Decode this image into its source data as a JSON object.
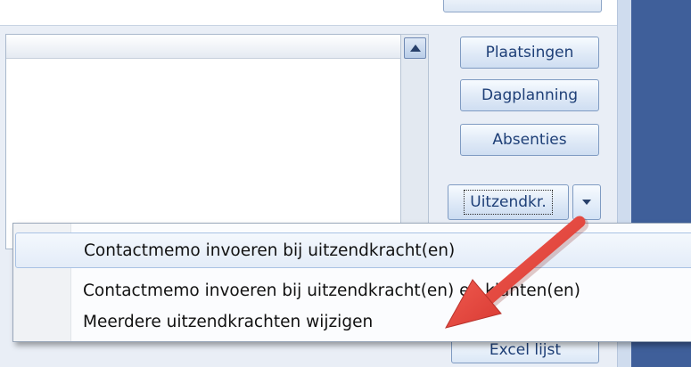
{
  "toolbar": {
    "side_buttons": [
      {
        "label": "Plaatsingen"
      },
      {
        "label": "Dagplanning"
      },
      {
        "label": "Absenties"
      }
    ],
    "split_button": {
      "label": "Uitzendkr.",
      "arrow_icon": "dropdown-arrow-icon"
    },
    "partially_hidden_button": {
      "label": "Excel lijst"
    }
  },
  "context_menu": {
    "items": [
      {
        "label": "Contactmemo invoeren bij uitzendkracht(en)",
        "highlighted": true
      },
      {
        "label": "Contactmemo invoeren bij uitzendkracht(en) en klanten(en)",
        "highlighted": false
      },
      {
        "label": "Meerdere uitzendkrachten wijzigen",
        "highlighted": false
      }
    ]
  },
  "annotation": {
    "type": "red-arrow",
    "color": "#e0413a"
  },
  "colors": {
    "button_text": "#1e3f77",
    "button_border": "#7f9bc2",
    "right_background": "#3f5f9a",
    "menu_highlight_border": "#a9c2e4"
  }
}
